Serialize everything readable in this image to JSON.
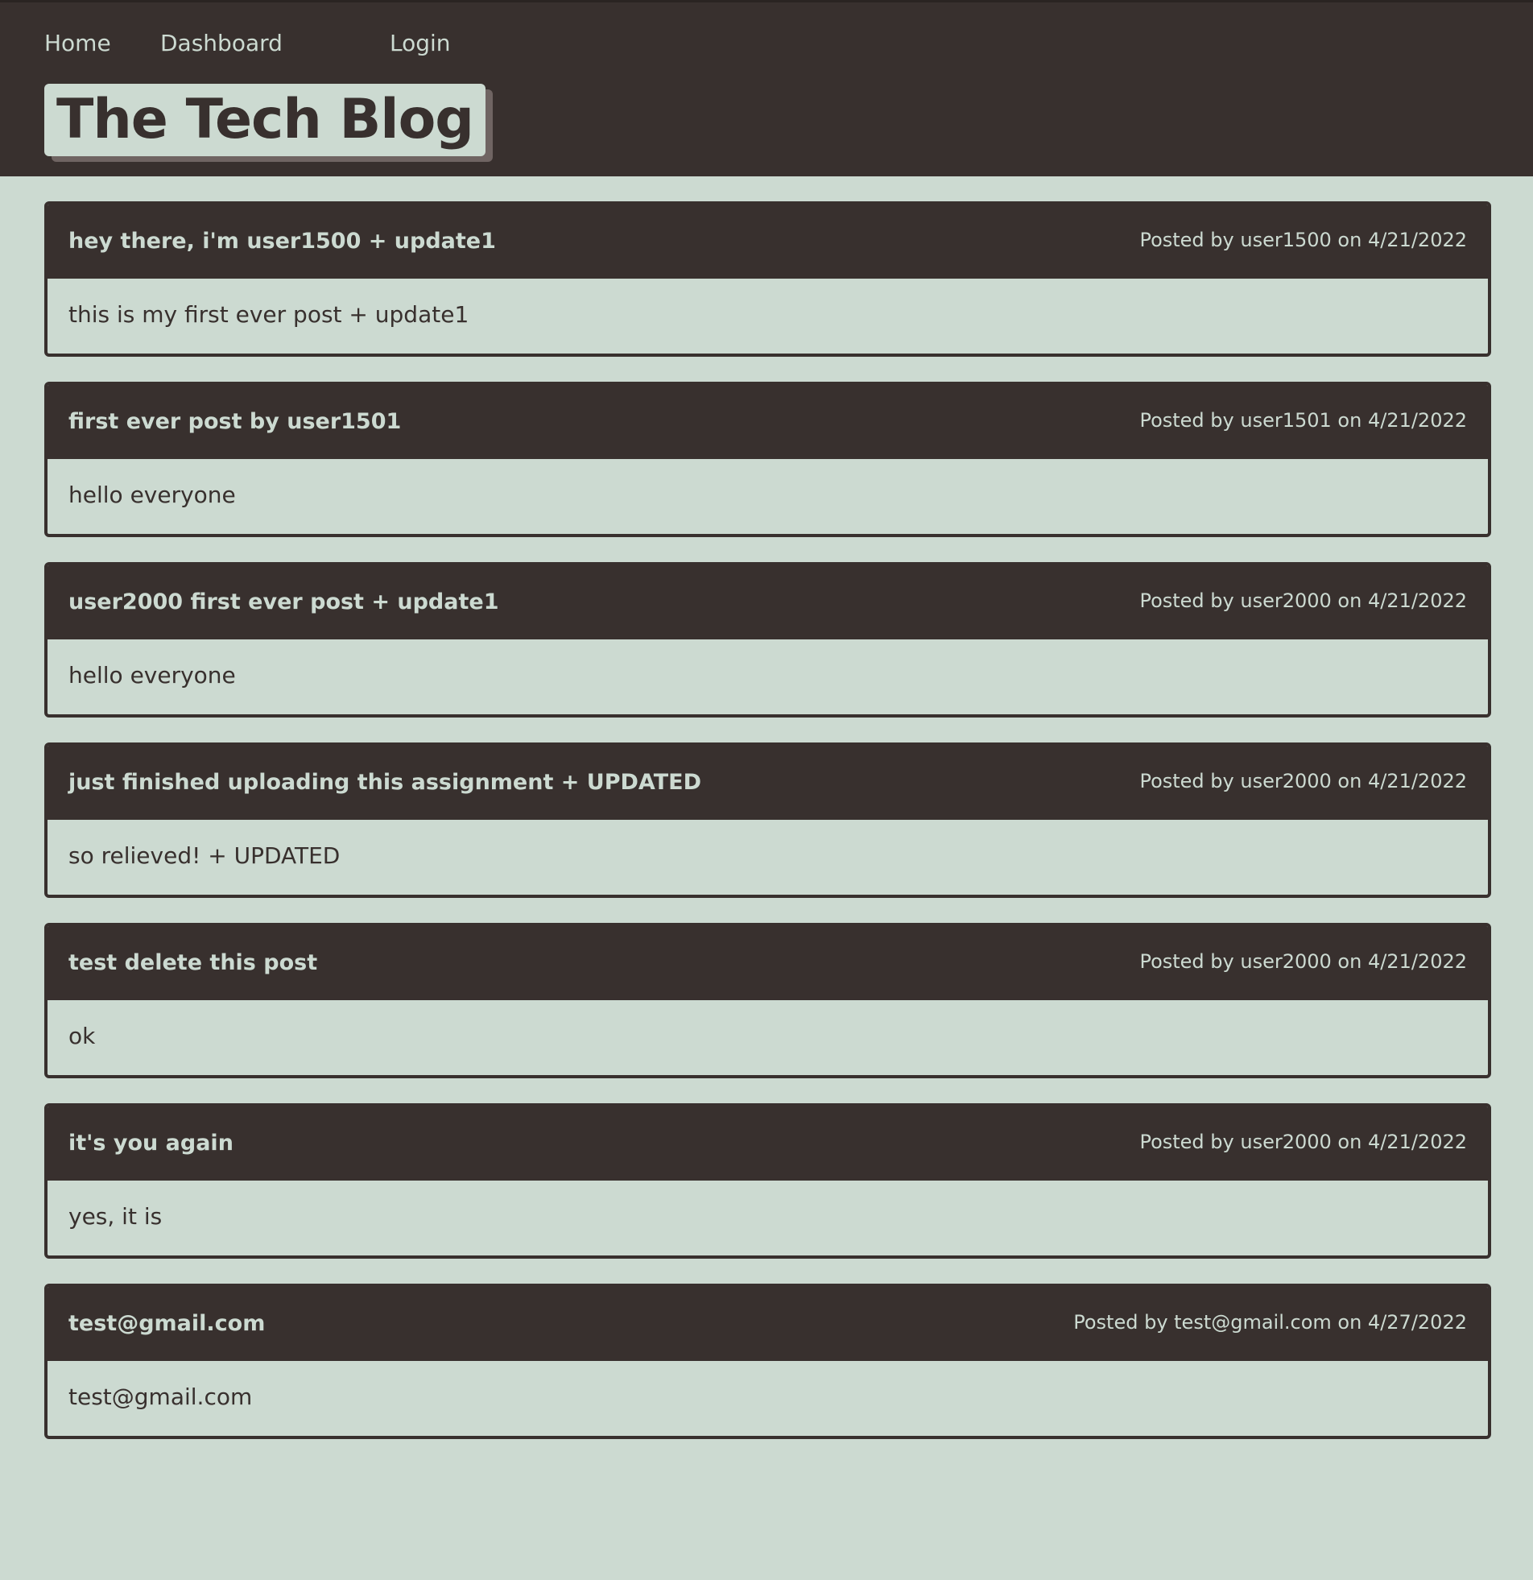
{
  "nav": {
    "home": "Home",
    "dashboard": "Dashboard",
    "login": "Login"
  },
  "site": {
    "title": "The Tech Blog"
  },
  "posts": [
    {
      "title": "hey there, i'm user1500 + update1",
      "meta": "Posted by user1500 on 4/21/2022",
      "body": "this is my first ever post + update1"
    },
    {
      "title": "first ever post by user1501",
      "meta": "Posted by user1501 on 4/21/2022",
      "body": "hello everyone"
    },
    {
      "title": "user2000 first ever post + update1",
      "meta": "Posted by user2000 on 4/21/2022",
      "body": "hello everyone"
    },
    {
      "title": "just finished uploading this assignment + UPDATED",
      "meta": "Posted by user2000 on 4/21/2022",
      "body": "so relieved! + UPDATED"
    },
    {
      "title": "test delete this post",
      "meta": "Posted by user2000 on 4/21/2022",
      "body": "ok"
    },
    {
      "title": "it's you again",
      "meta": "Posted by user2000 on 4/21/2022",
      "body": "yes, it is"
    },
    {
      "title": "test@gmail.com",
      "meta": "Posted by test@gmail.com on 4/27/2022",
      "body": "test@gmail.com"
    }
  ],
  "colors": {
    "dark": "#38302e",
    "light": "#ccdad1",
    "shadow": "#6f6462"
  }
}
